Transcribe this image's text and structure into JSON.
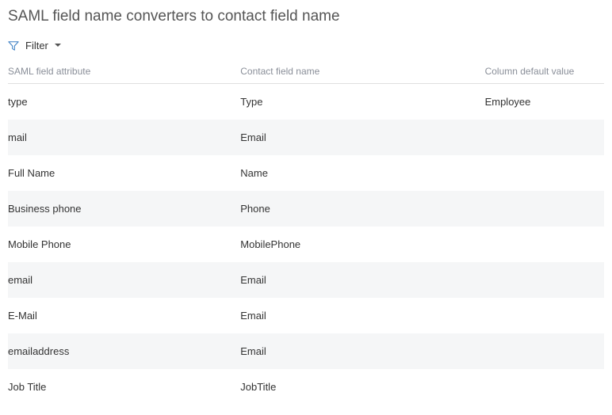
{
  "page_title": "SAML field name converters to contact field name",
  "filter": {
    "label": "Filter"
  },
  "table": {
    "headers": {
      "col1": "SAML field attribute",
      "col2": "Contact field name",
      "col3": "Column default value"
    },
    "rows": [
      {
        "saml": "type",
        "contact": "Type",
        "default": "Employee"
      },
      {
        "saml": "mail",
        "contact": "Email",
        "default": ""
      },
      {
        "saml": "Full Name",
        "contact": "Name",
        "default": ""
      },
      {
        "saml": "Business phone",
        "contact": "Phone",
        "default": ""
      },
      {
        "saml": "Mobile Phone",
        "contact": "MobilePhone",
        "default": ""
      },
      {
        "saml": "email",
        "contact": "Email",
        "default": ""
      },
      {
        "saml": "E-Mail",
        "contact": "Email",
        "default": ""
      },
      {
        "saml": "emailaddress",
        "contact": "Email",
        "default": ""
      },
      {
        "saml": "Job Title",
        "contact": "JobTitle",
        "default": ""
      }
    ]
  }
}
